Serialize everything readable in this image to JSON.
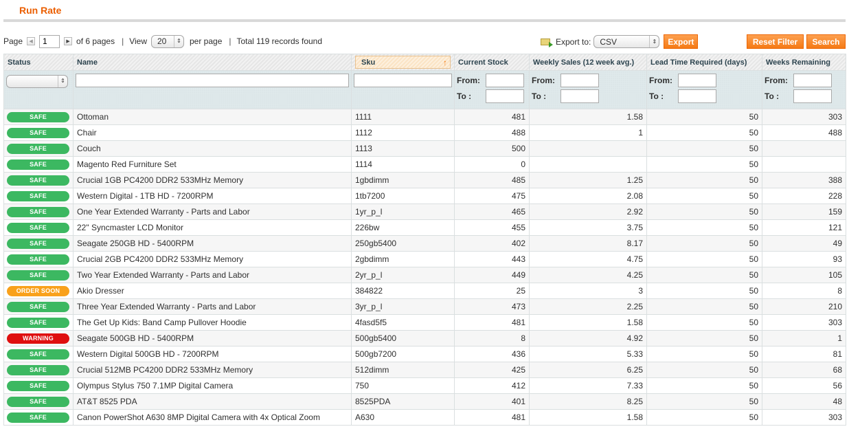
{
  "page": {
    "title": "Run Rate"
  },
  "pager": {
    "page_label": "Page",
    "current_page": "1",
    "of_pages": "of 6 pages",
    "separator": "|",
    "view_label": "View",
    "per_page": "20",
    "per_page_label": "per page",
    "total": "Total 119 records found"
  },
  "export": {
    "label": "Export to:",
    "format": "CSV",
    "button": "Export"
  },
  "actions": {
    "reset_filter": "Reset Filter",
    "search": "Search"
  },
  "filters": {
    "from_label": "From:",
    "to_label": "To :",
    "status_value": ""
  },
  "colors": {
    "accent": "#eb5e00",
    "safe": "#3cb861",
    "order_soon": "#f9a11b",
    "warning": "#df0f0f"
  },
  "table": {
    "columns": [
      "Status",
      "Name",
      "Sku",
      "Current Stock",
      "Weekly Sales (12 week avg.)",
      "Lead Time Required (days)",
      "Weeks Remaining"
    ],
    "sorted_column": "Sku",
    "sort_direction": "ascending",
    "rows": [
      {
        "status": "SAFE",
        "status_type": "safe",
        "name": "Ottoman",
        "sku": "1111",
        "stock": "481",
        "weekly": "1.58",
        "lead": "50",
        "weeks": "303"
      },
      {
        "status": "SAFE",
        "status_type": "safe",
        "name": "Chair",
        "sku": "1112",
        "stock": "488",
        "weekly": "1",
        "lead": "50",
        "weeks": "488"
      },
      {
        "status": "SAFE",
        "status_type": "safe",
        "name": "Couch",
        "sku": "1113",
        "stock": "500",
        "weekly": "",
        "lead": "50",
        "weeks": ""
      },
      {
        "status": "SAFE",
        "status_type": "safe",
        "name": "Magento Red Furniture Set",
        "sku": "1114",
        "stock": "0",
        "weekly": "",
        "lead": "50",
        "weeks": ""
      },
      {
        "status": "SAFE",
        "status_type": "safe",
        "name": "Crucial 1GB PC4200 DDR2 533MHz Memory",
        "sku": "1gbdimm",
        "stock": "485",
        "weekly": "1.25",
        "lead": "50",
        "weeks": "388"
      },
      {
        "status": "SAFE",
        "status_type": "safe",
        "name": "Western Digital - 1TB HD - 7200RPM",
        "sku": "1tb7200",
        "stock": "475",
        "weekly": "2.08",
        "lead": "50",
        "weeks": "228"
      },
      {
        "status": "SAFE",
        "status_type": "safe",
        "name": "One Year Extended Warranty - Parts and Labor",
        "sku": "1yr_p_l",
        "stock": "465",
        "weekly": "2.92",
        "lead": "50",
        "weeks": "159"
      },
      {
        "status": "SAFE",
        "status_type": "safe",
        "name": "22\" Syncmaster LCD Monitor",
        "sku": "226bw",
        "stock": "455",
        "weekly": "3.75",
        "lead": "50",
        "weeks": "121"
      },
      {
        "status": "SAFE",
        "status_type": "safe",
        "name": "Seagate 250GB HD - 5400RPM",
        "sku": "250gb5400",
        "stock": "402",
        "weekly": "8.17",
        "lead": "50",
        "weeks": "49"
      },
      {
        "status": "SAFE",
        "status_type": "safe",
        "name": "Crucial 2GB PC4200 DDR2 533MHz Memory",
        "sku": "2gbdimm",
        "stock": "443",
        "weekly": "4.75",
        "lead": "50",
        "weeks": "93"
      },
      {
        "status": "SAFE",
        "status_type": "safe",
        "name": "Two Year Extended Warranty - Parts and Labor",
        "sku": "2yr_p_l",
        "stock": "449",
        "weekly": "4.25",
        "lead": "50",
        "weeks": "105"
      },
      {
        "status": "ORDER SOON",
        "status_type": "order",
        "name": "Akio Dresser",
        "sku": "384822",
        "stock": "25",
        "weekly": "3",
        "lead": "50",
        "weeks": "8"
      },
      {
        "status": "SAFE",
        "status_type": "safe",
        "name": "Three Year Extended Warranty - Parts and Labor",
        "sku": "3yr_p_l",
        "stock": "473",
        "weekly": "2.25",
        "lead": "50",
        "weeks": "210"
      },
      {
        "status": "SAFE",
        "status_type": "safe",
        "name": "The Get Up Kids: Band Camp Pullover Hoodie",
        "sku": "4fasd5f5",
        "stock": "481",
        "weekly": "1.58",
        "lead": "50",
        "weeks": "303"
      },
      {
        "status": "WARNING",
        "status_type": "warn",
        "name": "Seagate 500GB HD - 5400RPM",
        "sku": "500gb5400",
        "stock": "8",
        "weekly": "4.92",
        "lead": "50",
        "weeks": "1"
      },
      {
        "status": "SAFE",
        "status_type": "safe",
        "name": "Western Digital 500GB HD - 7200RPM",
        "sku": "500gb7200",
        "stock": "436",
        "weekly": "5.33",
        "lead": "50",
        "weeks": "81"
      },
      {
        "status": "SAFE",
        "status_type": "safe",
        "name": "Crucial 512MB PC4200 DDR2 533MHz Memory",
        "sku": "512dimm",
        "stock": "425",
        "weekly": "6.25",
        "lead": "50",
        "weeks": "68"
      },
      {
        "status": "SAFE",
        "status_type": "safe",
        "name": "Olympus Stylus 750 7.1MP Digital Camera",
        "sku": "750",
        "stock": "412",
        "weekly": "7.33",
        "lead": "50",
        "weeks": "56"
      },
      {
        "status": "SAFE",
        "status_type": "safe",
        "name": "AT&T 8525 PDA",
        "sku": "8525PDA",
        "stock": "401",
        "weekly": "8.25",
        "lead": "50",
        "weeks": "48"
      },
      {
        "status": "SAFE",
        "status_type": "safe",
        "name": "Canon PowerShot A630 8MP Digital Camera with 4x Optical Zoom",
        "sku": "A630",
        "stock": "481",
        "weekly": "1.58",
        "lead": "50",
        "weeks": "303"
      }
    ]
  }
}
